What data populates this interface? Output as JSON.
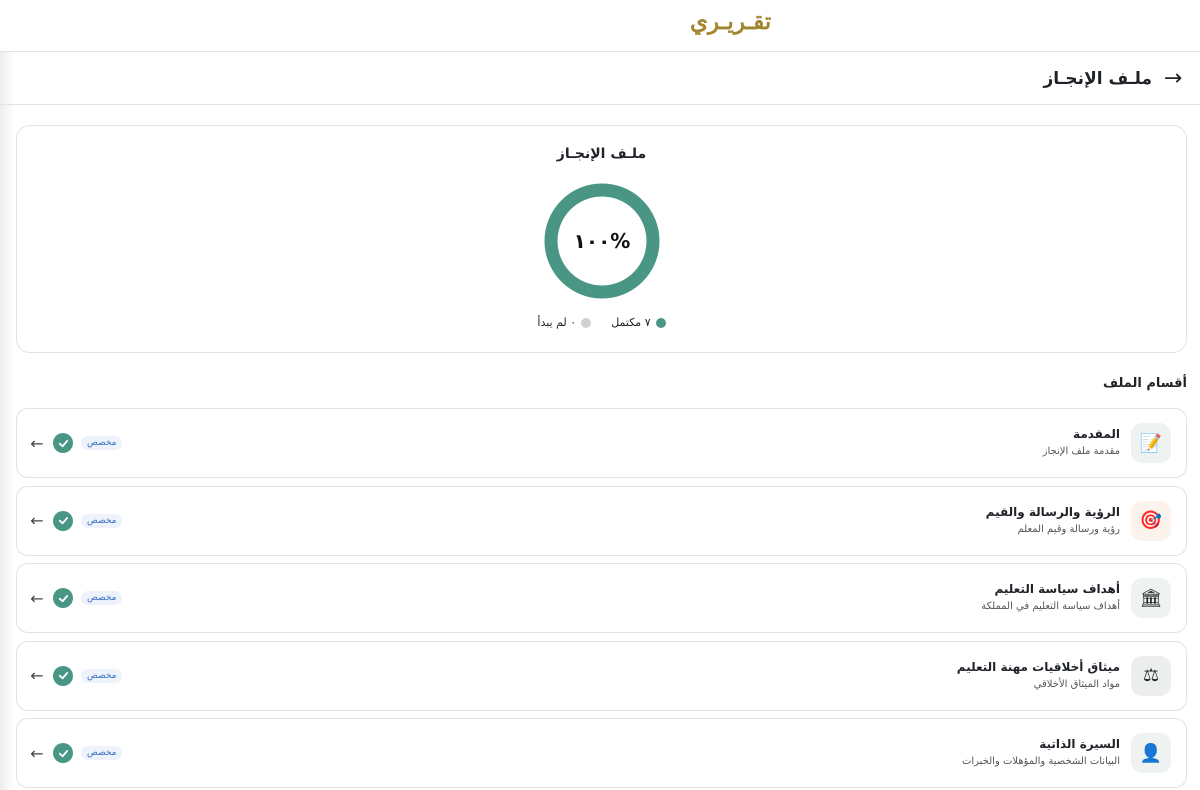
{
  "brand": {
    "name": "تقـريـري"
  },
  "header": {
    "title": "ملـف الإنجـاز",
    "back_icon": "arrow-right-icon"
  },
  "progress": {
    "title": "ملـف الإنجـاز",
    "percent_label": "%١٠٠",
    "percent": 100,
    "ring_color": "#4a9685",
    "legend": {
      "completed": "٧ مكتمل",
      "not_started": "٠ لم يبدأ"
    }
  },
  "sections_heading": "أقسام الملف",
  "sections": [
    {
      "title": "المقدمة",
      "subtitle": "مقدمة ملف الإنجاز",
      "badge": "مخصص",
      "icon": "memo-icon",
      "glyph": "📝"
    },
    {
      "title": "الرؤية والرسالة والقيم",
      "subtitle": "رؤية ورسالة وقيم المعلم",
      "badge": "مخصص",
      "icon": "target-icon",
      "glyph": "🎯"
    },
    {
      "title": "أهداف سياسة التعليم",
      "subtitle": "أهداف سياسة التعليم في المملكة",
      "badge": "مخصص",
      "icon": "classical-building-icon",
      "glyph": "🏛"
    },
    {
      "title": "ميثاق أخلاقيات مهنة التعليم",
      "subtitle": "مواد الميثاق الأخلاقي",
      "badge": "مخصص",
      "icon": "balance-scale-icon",
      "glyph": "⚖"
    },
    {
      "title": "السيرة الذاتية",
      "subtitle": "البيانات الشخصية والمؤهلات والخبرات",
      "badge": "مخصص",
      "icon": "person-icon",
      "glyph": "👤"
    }
  ]
}
